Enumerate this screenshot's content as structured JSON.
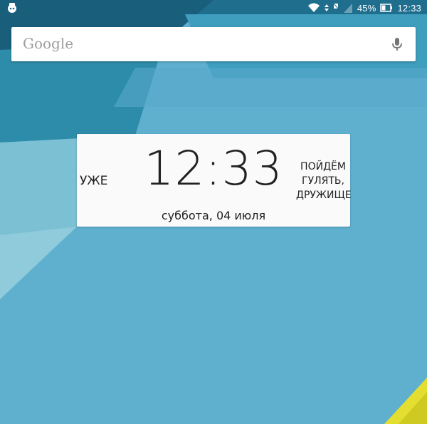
{
  "status_bar": {
    "left_icon": "notification-app-icon",
    "wifi_icon": "wifi-icon",
    "sim_icon": "no-sim-icon",
    "signal_icon": "signal-icon",
    "battery_percent": "45%",
    "battery_level": 0.45,
    "battery_icon": "battery-icon",
    "time": "12:33"
  },
  "search": {
    "logo_text": "Google",
    "mic_icon": "mic-icon"
  },
  "widget": {
    "left_text": "УЖЕ",
    "time": "12:33",
    "date": "суббота, 04 июля",
    "right_lines": [
      "ПОЙДЁМ",
      "ГУЛЯТЬ,",
      "ДРУЖИЩЕ"
    ]
  },
  "colors": {
    "wallpaper_main": "#5fb0cf",
    "wallpaper_dark": "#1e6f8f",
    "wallpaper_teal": "#2f8fae",
    "wallpaper_light": "#8ec9d9",
    "accent_yellow": "#e7e23a",
    "widget_bg": "#fafafa"
  }
}
